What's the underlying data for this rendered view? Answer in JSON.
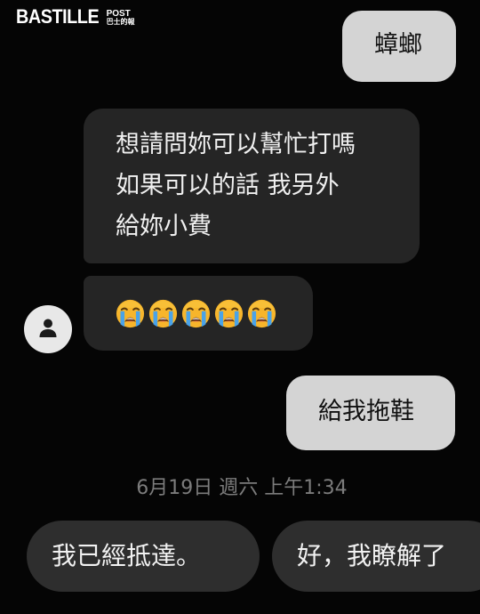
{
  "watermark": {
    "main": "BASTILLE",
    "side_top": "POST",
    "side_bottom": "巴士的報"
  },
  "messages": [
    {
      "direction": "outgoing",
      "lines": [
        "蟑螂"
      ]
    },
    {
      "direction": "incoming",
      "lines": [
        "想請問妳可以幫忙打嗎",
        "如果可以的話 我另外",
        "給妳小費"
      ]
    },
    {
      "direction": "incoming",
      "emoji": [
        "loudly-crying-face",
        "loudly-crying-face",
        "loudly-crying-face",
        "loudly-crying-face",
        "loudly-crying-face"
      ],
      "emoji_char": "😭"
    },
    {
      "direction": "outgoing",
      "lines": [
        "給我拖鞋"
      ]
    }
  ],
  "avatar": {
    "icon": "person-icon"
  },
  "timestamp": "6月19日 週六 上午1:34",
  "quick_replies": [
    "我已經抵達。",
    "好，我瞭解了"
  ],
  "colors": {
    "background": "#050505",
    "outgoing_bubble": "#d4d4d4",
    "incoming_bubble": "#252525",
    "quick_reply": "#2e2e2e",
    "timestamp": "#7c7c7c"
  }
}
